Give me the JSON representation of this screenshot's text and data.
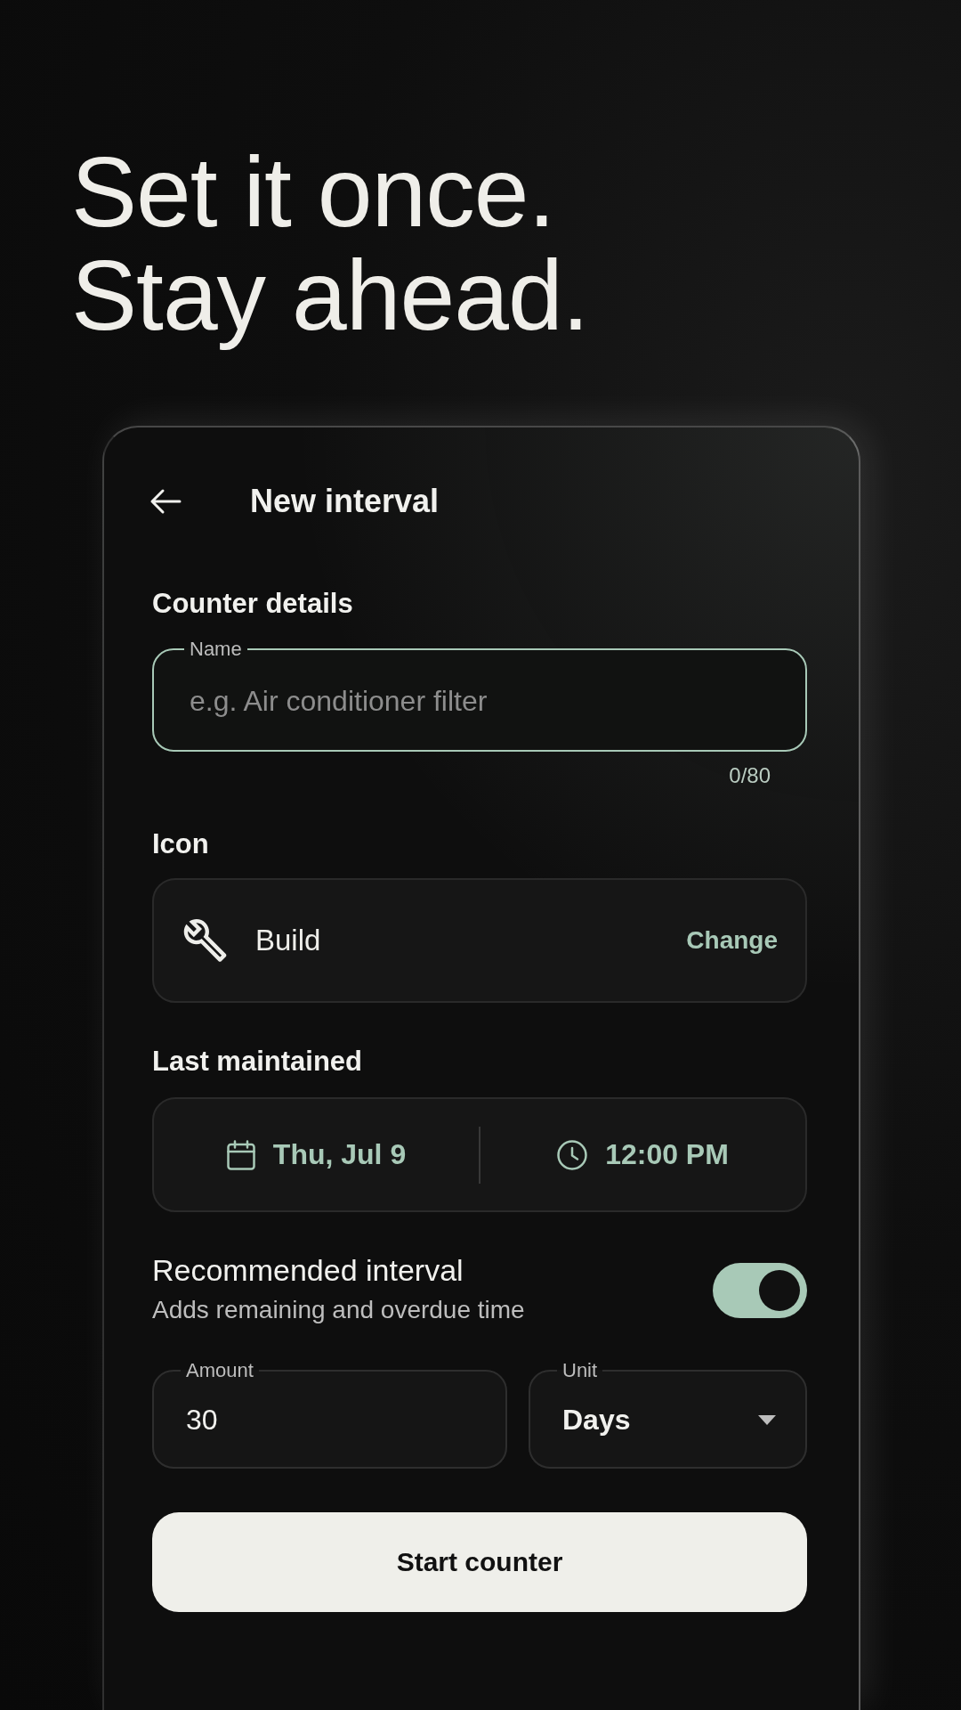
{
  "headline": [
    "Set it once.",
    "Stay ahead."
  ],
  "screen": {
    "title": "New interval"
  },
  "counter_details": {
    "heading": "Counter details",
    "name_field": {
      "label": "Name",
      "placeholder": "e.g. Air conditioner filter",
      "focused": true,
      "counter": "0/80"
    }
  },
  "icon": {
    "heading": "Icon",
    "name": "Build",
    "action": "Change"
  },
  "last_maintained": {
    "heading": "Last maintained",
    "date": "Thu, Jul 9",
    "time": "12:00 PM"
  },
  "recommended_interval": {
    "title": "Recommended interval",
    "subtitle": "Adds remaining and overdue time",
    "on": true
  },
  "amount_field": {
    "label": "Amount",
    "value": "30"
  },
  "unit_field": {
    "label": "Unit",
    "value": "Days"
  },
  "primary_button": "Start counter"
}
